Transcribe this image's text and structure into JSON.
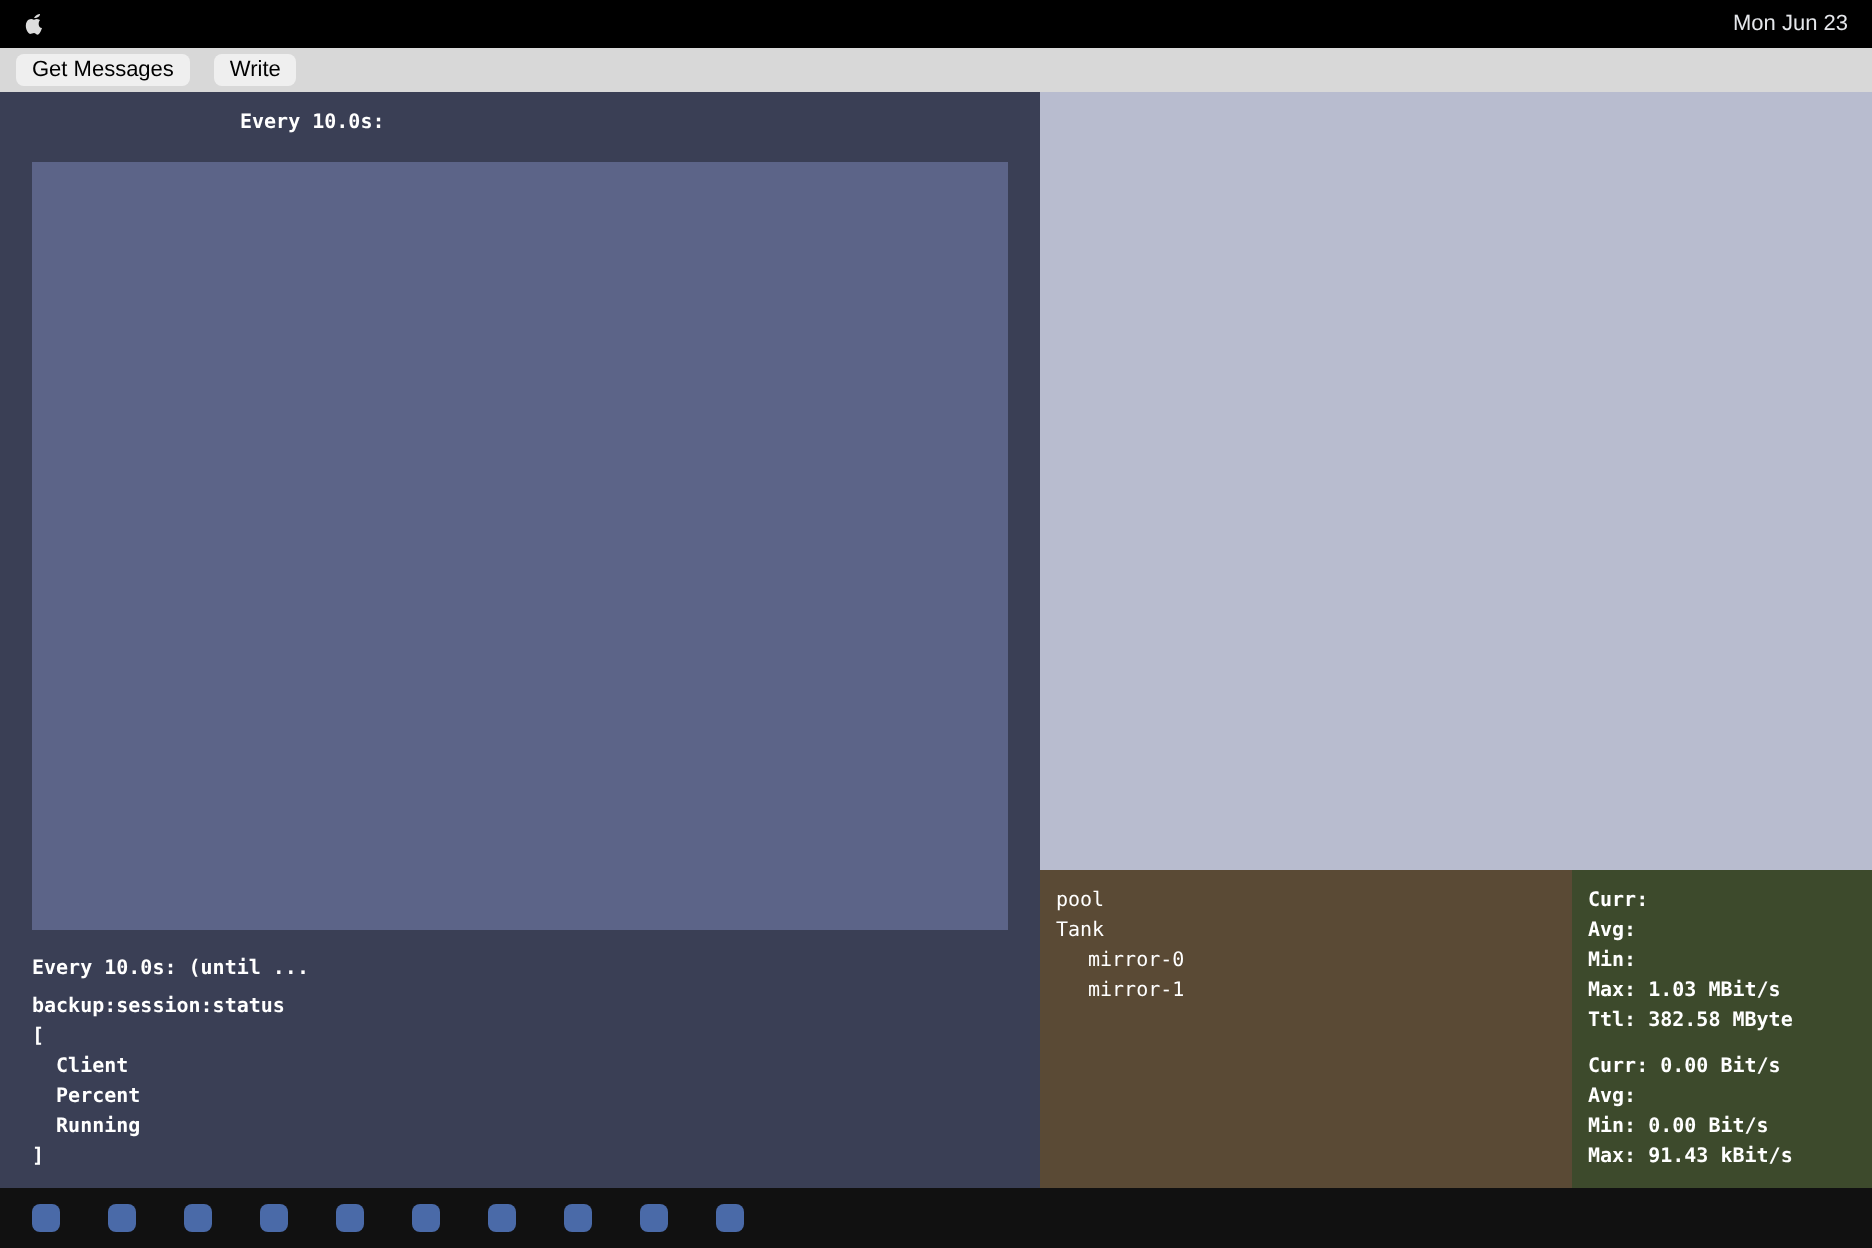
{
  "menu_bar": {
    "clock": "Mon Jun 23"
  },
  "mail_toolbar": {
    "buttons": [
      "Get Messages",
      "Write"
    ]
  },
  "watch_top": {
    "header": "Every 10.0s:"
  },
  "watch_bottom": {
    "header": "Every 10.0s: (until ...",
    "lines": [
      "backup:session:status",
      "[",
      "  Client",
      "  Percent",
      "  Running",
      "]"
    ]
  },
  "pool": {
    "title": "pool",
    "tree": [
      {
        "label": "Tank",
        "children": [
          {
            "label": "mirror-0"
          },
          {
            "label": "mirror-1"
          }
        ]
      }
    ]
  },
  "network": {
    "incoming": [
      "Curr:",
      "Avg:",
      "Min:",
      "Max: 1.03 MBit/s",
      "Ttl: 382.58 MByte"
    ],
    "outgoing": [
      "Curr: 0.00 Bit/s",
      "Avg:",
      "Min: 0.00 Bit/s",
      "Max: 91.43 kBit/s"
    ]
  }
}
